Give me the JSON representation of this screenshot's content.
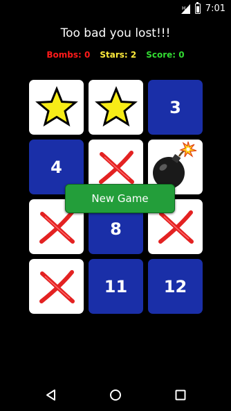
{
  "status_bar": {
    "time": "7:01",
    "icons": [
      "signal-icon",
      "battery-icon"
    ]
  },
  "game": {
    "message": "Too bad you lost!!!",
    "scores": {
      "bombs": "Bombs: 0",
      "stars": "Stars: 2",
      "score": "Score: 0"
    },
    "colors": {
      "bombs": "#ff1a1a",
      "stars": "#ffeb3b",
      "score": "#33dd33",
      "tile_blue": "#1a2fa8",
      "button": "#239e3a"
    },
    "tiles": [
      {
        "kind": "star-icon",
        "label": ""
      },
      {
        "kind": "star-icon",
        "label": ""
      },
      {
        "kind": "number",
        "label": "3"
      },
      {
        "kind": "number",
        "label": "4"
      },
      {
        "kind": "cross-icon",
        "label": ""
      },
      {
        "kind": "bomb-icon",
        "label": ""
      },
      {
        "kind": "cross-icon",
        "label": ""
      },
      {
        "kind": "number",
        "label": "8"
      },
      {
        "kind": "cross-icon",
        "label": ""
      },
      {
        "kind": "cross-icon",
        "label": ""
      },
      {
        "kind": "number",
        "label": "11"
      },
      {
        "kind": "number",
        "label": "12"
      }
    ],
    "new_game_label": "New Game"
  },
  "nav_bar": {
    "icons": [
      "back-icon",
      "home-icon",
      "recents-icon"
    ]
  }
}
